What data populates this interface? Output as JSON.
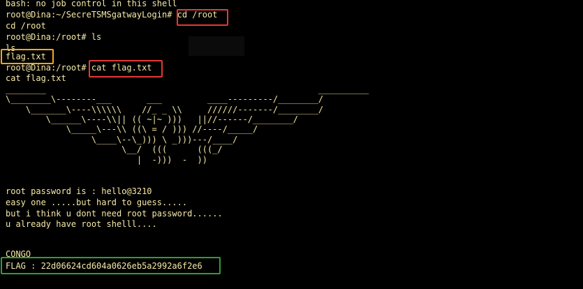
{
  "terminal": {
    "lines": [
      "bash: no job control in this shell",
      "root@Dina:~/SecreTSMSgatwayLogin# cd /root",
      "cd /root",
      "root@Dina:/root# ls",
      "ls",
      "flag.txt",
      "root@Dina:/root# cat flag.txt",
      "cat flag.txt",
      "________                                                      __________",
      "\\________\\--------___       ___         ____---------/________/",
      "    \\_______\\----\\\\\\\\\\\\    //_ _ \\\\     //////-------/________/",
      "        \\______\\----\\\\|| (( ~|~ )))   ||//------/________/",
      "            \\_____\\---\\\\ ((\\ = / ))) //----/_____/",
      "                 \\____\\--\\_))) \\ _)))---/____/",
      "                       \\__/  (((      (((_/",
      "                          |  -)))  -  ))",
      "",
      "root password is : hello@3210",
      "easy one .....but hard to guess.....",
      "but i think u dont need root password......",
      "u already have root shelll....",
      "",
      "CONGO",
      "FLAG : 22d06624cd604a0626eb5a2992a6f2e6"
    ]
  },
  "highlight_colors": {
    "command": "#e53935",
    "listing": "#f5a623",
    "flag": "#2e9e3a"
  },
  "text_color": "#f5e9a6",
  "background_color": "#000000"
}
